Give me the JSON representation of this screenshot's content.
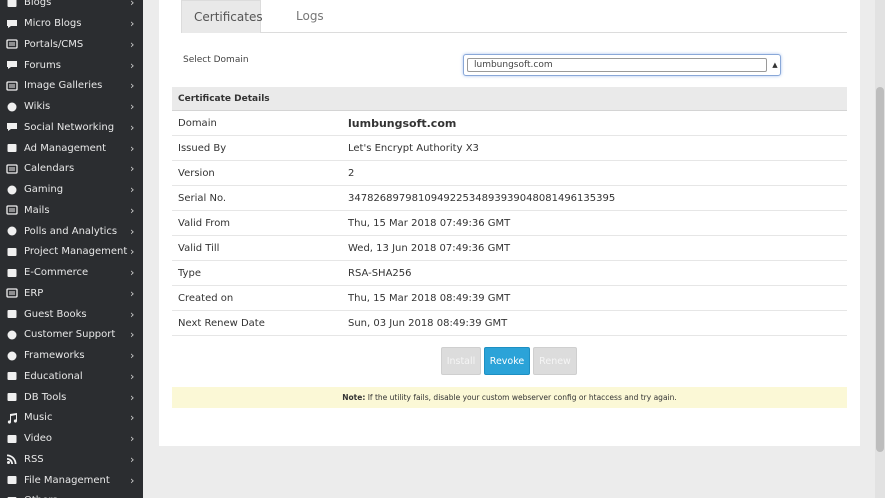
{
  "sidebar": {
    "items": [
      {
        "label": "Blogs",
        "icon": "blogs-icon"
      },
      {
        "label": "Micro Blogs",
        "icon": "micro-blogs-icon"
      },
      {
        "label": "Portals/CMS",
        "icon": "portals-icon"
      },
      {
        "label": "Forums",
        "icon": "forums-icon"
      },
      {
        "label": "Image Galleries",
        "icon": "image-galleries-icon"
      },
      {
        "label": "Wikis",
        "icon": "wikis-icon"
      },
      {
        "label": "Social Networking",
        "icon": "social-networking-icon"
      },
      {
        "label": "Ad Management",
        "icon": "ad-management-icon"
      },
      {
        "label": "Calendars",
        "icon": "calendars-icon"
      },
      {
        "label": "Gaming",
        "icon": "gaming-icon"
      },
      {
        "label": "Mails",
        "icon": "mails-icon"
      },
      {
        "label": "Polls and Analytics",
        "icon": "polls-icon"
      },
      {
        "label": "Project Management",
        "icon": "project-management-icon"
      },
      {
        "label": "E-Commerce",
        "icon": "e-commerce-icon"
      },
      {
        "label": "ERP",
        "icon": "erp-icon"
      },
      {
        "label": "Guest Books",
        "icon": "guest-books-icon"
      },
      {
        "label": "Customer Support",
        "icon": "customer-support-icon"
      },
      {
        "label": "Frameworks",
        "icon": "frameworks-icon"
      },
      {
        "label": "Educational",
        "icon": "educational-icon"
      },
      {
        "label": "DB Tools",
        "icon": "db-tools-icon"
      },
      {
        "label": "Music",
        "icon": "music-icon"
      },
      {
        "label": "Video",
        "icon": "video-icon"
      },
      {
        "label": "RSS",
        "icon": "rss-icon"
      },
      {
        "label": "File Management",
        "icon": "file-management-icon"
      },
      {
        "label": "Others",
        "icon": "others-icon"
      }
    ],
    "chevron": "›"
  },
  "tabs": {
    "certificates": "Certificates",
    "logs": "Logs"
  },
  "domain": {
    "label": "Select Domain",
    "selected": "lumbungsoft.com"
  },
  "details": {
    "heading": "Certificate Details",
    "rows": [
      {
        "key": "Domain",
        "value": "lumbungsoft.com"
      },
      {
        "key": "Issued By",
        "value": "Let's Encrypt Authority X3"
      },
      {
        "key": "Version",
        "value": "2"
      },
      {
        "key": "Serial No.",
        "value": "347826897981094922534893939048081496135395"
      },
      {
        "key": "Valid From",
        "value": "Thu, 15 Mar 2018 07:49:36 GMT"
      },
      {
        "key": "Valid Till",
        "value": "Wed, 13 Jun 2018 07:49:36 GMT"
      },
      {
        "key": "Type",
        "value": "RSA-SHA256"
      },
      {
        "key": "Created on",
        "value": "Thu, 15 Mar 2018 08:49:39 GMT"
      },
      {
        "key": "Next Renew Date",
        "value": "Sun, 03 Jun 2018 08:49:39 GMT"
      }
    ]
  },
  "buttons": {
    "install": "Install",
    "revoke": "Revoke",
    "renew": "Renew"
  },
  "note": {
    "prefix": "Note:",
    "text": " If the utility fails, disable your custom webserver config or htaccess and try again."
  },
  "colors": {
    "sidebar_bg": "#2b2d30",
    "accent": "#2ba3d8",
    "note_bg": "#fbf8d6"
  }
}
